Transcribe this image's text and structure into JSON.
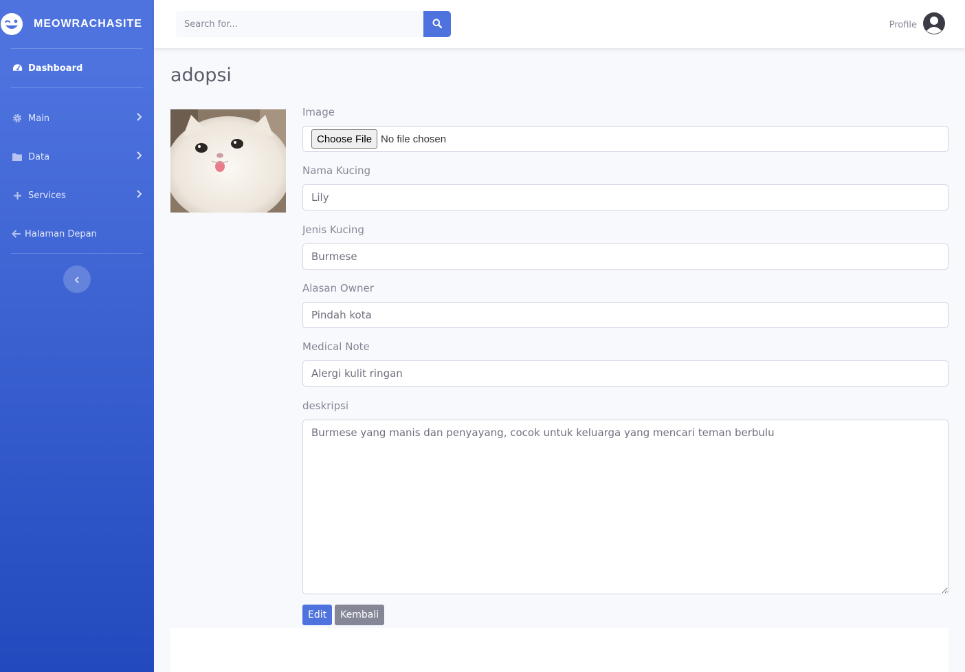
{
  "brand": {
    "name": "MEOWRACHASITE"
  },
  "sidebar": {
    "items": [
      {
        "label": "Dashboard",
        "icon": "dashboard-icon"
      },
      {
        "label": "Main",
        "icon": "gear-icon"
      },
      {
        "label": "Data",
        "icon": "folder-icon"
      },
      {
        "label": "Services",
        "icon": "plus-icon"
      },
      {
        "label": "Halaman Depan",
        "icon": "arrow-left-icon"
      }
    ]
  },
  "topbar": {
    "search_placeholder": "Search for...",
    "profile_label": "Profile"
  },
  "page": {
    "title": "adopsi"
  },
  "form": {
    "image_label": "Image",
    "file_button": "Choose File",
    "file_status": "No file chosen",
    "nama_label": "Nama Kucing",
    "nama_value": "Lily",
    "jenis_label": "Jenis Kucing",
    "jenis_value": "Burmese",
    "alasan_label": "Alasan Owner",
    "alasan_value": "Pindah kota",
    "medical_label": "Medical Note",
    "medical_value": "Alergi kulit ringan",
    "deskripsi_label": "deskripsi",
    "deskripsi_value": "Burmese yang manis dan penyayang, cocok untuk keluarga yang mencari teman berbulu",
    "edit_button": "Edit",
    "back_button": "Kembali"
  },
  "colors": {
    "primary": "#4e73df",
    "secondary": "#858796",
    "sidebar_top": "#4e73df",
    "sidebar_bottom": "#224abe"
  }
}
